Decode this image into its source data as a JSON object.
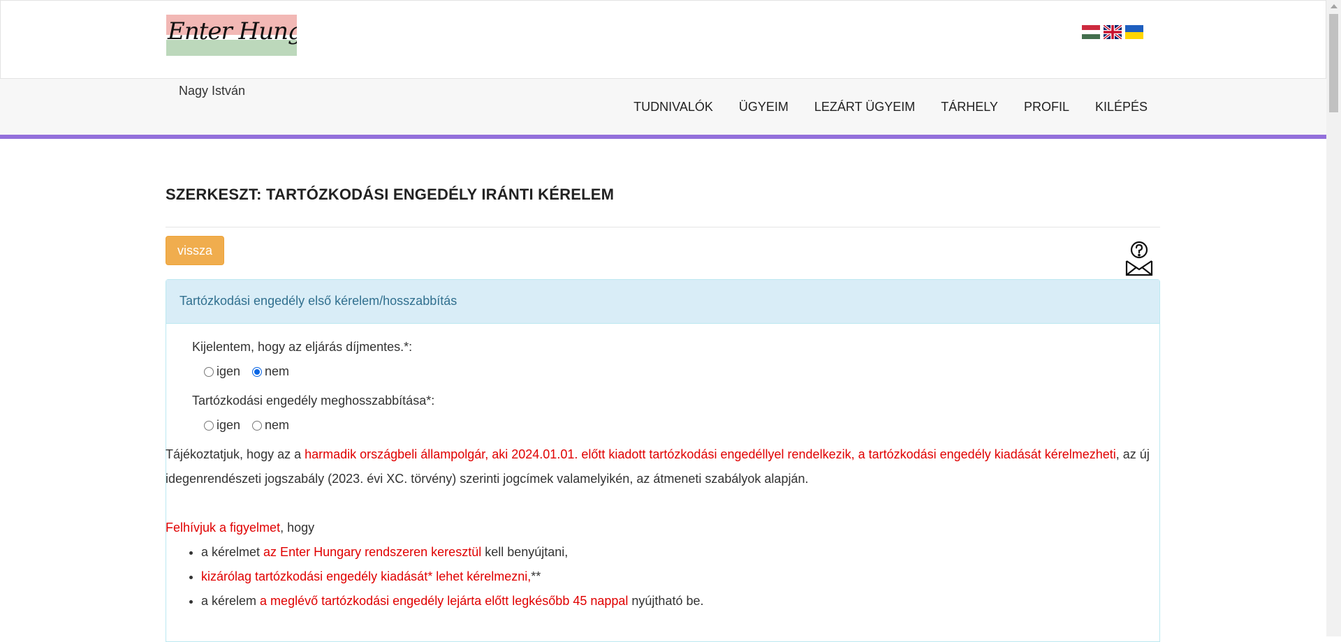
{
  "header": {
    "logo_text": "Enter Hungary",
    "flags": [
      "hungarian-flag-icon",
      "uk-flag-icon",
      "ukrainian-flag-icon"
    ]
  },
  "nav": {
    "user_name": "Nagy István",
    "items": [
      "TUDNIVALÓK",
      "ÜGYEIM",
      "LEZÁRT ÜGYEIM",
      "TÁRHELY",
      "PROFIL",
      "KILÉPÉS"
    ],
    "accent_color": "#9370db"
  },
  "main": {
    "page_title": "SZERKESZT: TARTÓZKODÁSI ENGEDÉLY IRÁNTI KÉRELEM",
    "back_button": "vissza",
    "panel_title": "Tartózkodási engedély első kérelem/hosszabbítás",
    "question1": {
      "label": "Kijelentem, hogy az eljárás díjmentes.*:",
      "options": [
        "igen",
        "nem"
      ],
      "selected": "nem"
    },
    "question2": {
      "label": "Tartózkodási engedély meghosszabbítása*:",
      "options": [
        "igen",
        "nem"
      ],
      "selected": ""
    },
    "info": {
      "p1_a": "Tájékoztatjuk, hogy az a ",
      "p1_red": "harmadik országbeli állampolgár, aki 2024.01.01. előtt kiadott tartózkodási engedéllyel rendelkezik, a tartózkodási engedély kiadását kérelmezheti",
      "p1_b": ", az új idegenrendészeti jogszabály (2023. évi XC. törvény) szerinti jogcímek valamelyikén, az átmeneti szabályok alapján.",
      "p2_red": "Felhívjuk a figyelmet",
      "p2_b": ", hogy",
      "bullets": [
        {
          "a": "a kérelmet ",
          "red": "az Enter Hungary rendszeren keresztül",
          "b": " kell benyújtani,"
        },
        {
          "a": "",
          "red": "kizárólag tartózkodási engedély kiadását* lehet kérelmezni,",
          "b": "**"
        },
        {
          "a": "a kérelem ",
          "red": "a meglévő tartózkodási engedély lejárta előtt legkésőbb 45 nappal",
          "b": " nyújtható be."
        }
      ]
    }
  }
}
